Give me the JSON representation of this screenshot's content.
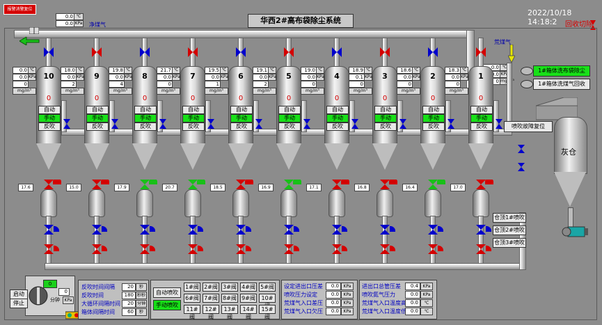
{
  "header": {
    "title": "华西2#高布袋除尘系统",
    "datetime": "2022/10/18 14:18:2",
    "recover_label": "回收切除",
    "alarm_button": "报警消警复位"
  },
  "gas": {
    "clean_label": "净煤气",
    "raw_label": "荒煤气",
    "top_value1": "0.0",
    "top_unit1": "℃",
    "top_value2": "0.0",
    "top_unit2": "KPa",
    "right_value1": "0.0",
    "right_unit1": "℃",
    "right_value2": "0.0",
    "right_unit2": "KPa",
    "right_value3": "0",
    "right_unit3": "mg/m³"
  },
  "units": [
    {
      "num": "10",
      "temp": "0.0",
      "press": "0.0",
      "val": "0",
      "dust": "mg/m³",
      "zero": "0",
      "low_temp": "17.6",
      "box_temp": "0.0",
      "box_press": "0.0",
      "side_val": "2"
    },
    {
      "num": "9",
      "temp": "18.0",
      "press": "0.0",
      "val": "2",
      "dust": "mg/m³",
      "zero": "0",
      "low_temp": "15.0"
    },
    {
      "num": "8",
      "temp": "19.8",
      "press": "0.0",
      "val": "4",
      "dust": "mg/m³",
      "zero": "0",
      "low_temp": "17.9"
    },
    {
      "num": "7",
      "temp": "21.7",
      "press": "0.0",
      "val": "0",
      "dust": "mg/m³",
      "zero": "0",
      "low_temp": "20.7"
    },
    {
      "num": "6",
      "temp": "19.5",
      "press": "0.0",
      "val": "1",
      "dust": "mg/m³",
      "zero": "0",
      "low_temp": "18.5"
    },
    {
      "num": "5",
      "temp": "19.1",
      "press": "0.0",
      "val": "2",
      "dust": "mg/m³",
      "zero": "0",
      "low_temp": "16.9"
    },
    {
      "num": "4",
      "temp": "19.0",
      "press": "0.0",
      "val": "0",
      "dust": "mg/m³",
      "zero": "0",
      "low_temp": "17.1"
    },
    {
      "num": "3",
      "temp": "18.9",
      "press": "0.1",
      "val": "0",
      "dust": "mg/m³",
      "zero": "0",
      "low_temp": "16.8"
    },
    {
      "num": "2",
      "temp": "18.6",
      "press": "0.0",
      "val": "0",
      "dust": "mg/m³",
      "zero": "0",
      "low_temp": "16.4"
    },
    {
      "num": "1",
      "temp": "18.3",
      "press": "0.0",
      "val": "0",
      "dust": "mg/m³",
      "zero": "0",
      "low_temp": "17.0"
    }
  ],
  "modes": {
    "auto": "自动",
    "manual": "手动",
    "reverse": "反吹"
  },
  "right_panel": {
    "btn1": "1#箱体洗布袋除尘",
    "btn2": "1#箱体洗煤气回收",
    "fault_reset": "喷吹故障复位",
    "ash_bin": "灰仓",
    "top1": "仓顶1#喷吹",
    "top2": "仓顶2#喷吹",
    "top3": "仓顶3#喷吹"
  },
  "bottom_left": {
    "start": "启动",
    "stop": "停止",
    "sw_label": "分钟",
    "val": "0",
    "unit": "KPa",
    "sw_value": "0"
  },
  "timing": [
    {
      "label": "反吹时间间隔",
      "value": "20",
      "unit": "秒"
    },
    {
      "label": "反吹时间",
      "value": "180",
      "unit": "秒秒"
    },
    {
      "label": "大循环间隔时间",
      "value": "20",
      "unit": "分钟"
    },
    {
      "label": "箱体间隔时间",
      "value": "60",
      "unit": "秒"
    }
  ],
  "blow": {
    "auto": "自动喷吹",
    "manual": "手动喷吹",
    "valves": [
      "1#阀",
      "2#阀",
      "3#阀",
      "4#阀",
      "5#阀",
      "6#阀",
      "7#阀",
      "8#阀",
      "9#阀",
      "10#阀",
      "11#阀",
      "12#阀",
      "13#阀",
      "14#阀",
      "15#阀"
    ]
  },
  "pressure": [
    {
      "label": "设定进出口压差",
      "value": "0.0",
      "unit": "KPa"
    },
    {
      "label": "喷吹压力设定",
      "value": "0.0",
      "unit": "KPa"
    },
    {
      "label": "荒煤气入口差压",
      "value": "0.0",
      "unit": "KPa"
    },
    {
      "label": "荒煤气入口欠压",
      "value": "0.0",
      "unit": "KPa"
    }
  ],
  "gas_panel": [
    {
      "label": "进出口总管压差",
      "value": "0.4",
      "unit": "KPa"
    },
    {
      "label": "喷吹氮气压力",
      "value": "0.0",
      "unit": "KPa"
    },
    {
      "label": "荒煤气入口温度高",
      "value": "0.0",
      "unit": "℃"
    },
    {
      "label": "荒煤气入口温度低",
      "value": "0.0",
      "unit": "℃"
    }
  ]
}
